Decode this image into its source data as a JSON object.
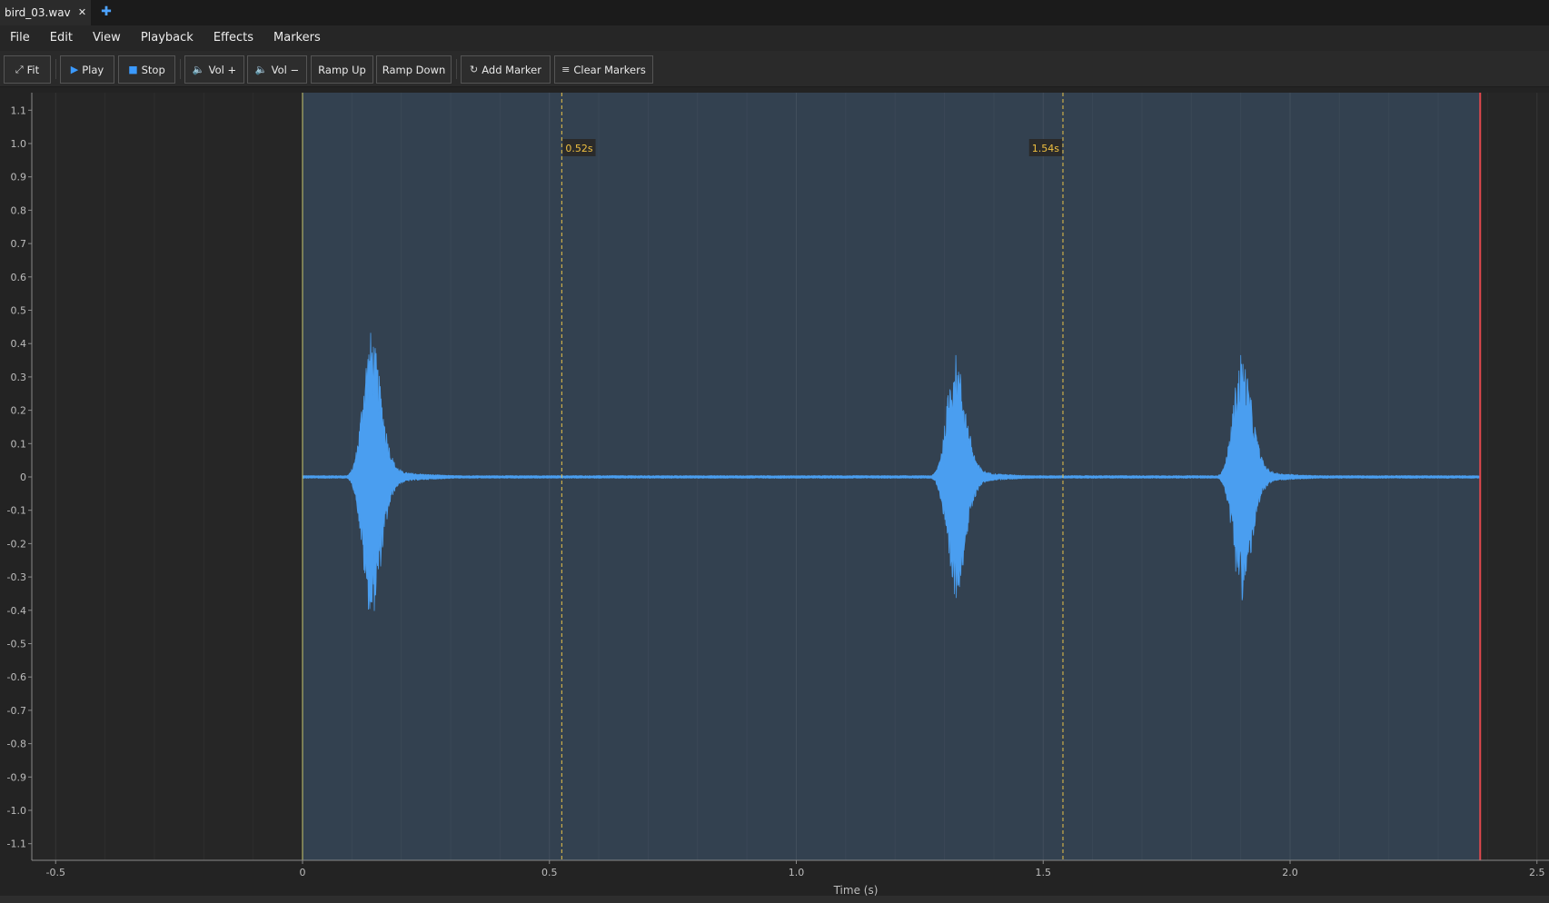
{
  "tab": {
    "title": "bird_03.wav",
    "close_glyph": "✕",
    "add_glyph": "✚"
  },
  "menu": [
    "File",
    "Edit",
    "View",
    "Playback",
    "Effects",
    "Markers"
  ],
  "toolbar": {
    "fit": {
      "label": "Fit",
      "icon": "expand-icon"
    },
    "play": {
      "label": "Play",
      "icon": "play-icon"
    },
    "stop": {
      "label": "Stop",
      "icon": "stop-icon"
    },
    "vol_up": {
      "label": "Vol +",
      "icon": "speaker-icon"
    },
    "vol_down": {
      "label": "Vol −",
      "icon": "speaker-icon"
    },
    "ramp_up": {
      "label": "Ramp Up"
    },
    "ramp_down": {
      "label": "Ramp Down"
    },
    "add_marker": {
      "label": "Add Marker",
      "icon": "marker-icon"
    },
    "clear_markers": {
      "label": "Clear Markers",
      "icon": "clear-icon"
    }
  },
  "chart_data": {
    "type": "line",
    "xlabel": "Time (s)",
    "ylabel": "",
    "xlim": [
      -0.5,
      2.5
    ],
    "ylim": [
      -1.15,
      1.15
    ],
    "x_ticks": [
      -0.5,
      0,
      0.5,
      1.0,
      1.5,
      2.0,
      2.5
    ],
    "x_tick_labels": [
      "-0.5",
      "0",
      "0.5",
      "1.0",
      "1.5",
      "2.0",
      "2.5"
    ],
    "y_ticks": [
      1.1,
      1.0,
      0.9,
      0.8,
      0.7,
      0.6,
      0.5,
      0.4,
      0.3,
      0.2,
      0.1,
      0,
      -0.1,
      -0.2,
      -0.3,
      -0.4,
      -0.5,
      -0.6,
      -0.7,
      -0.8,
      -0.9,
      -1.0,
      -1.1
    ],
    "y_tick_labels": [
      "1.1",
      "1.0",
      "0.9",
      "0.8",
      "0.7",
      "0.6",
      "0.5",
      "0.4",
      "0.3",
      "0.2",
      "0.1",
      "0",
      "-0.1",
      "-0.2",
      "-0.3",
      "-0.4",
      "-0.5",
      "-0.6",
      "-0.7",
      "-0.8",
      "-0.9",
      "-1.0",
      "-1.1"
    ],
    "audio_range": [
      0,
      2.385
    ],
    "playhead": 2.385,
    "markers": [
      {
        "time": 0.525,
        "label": "0.52s"
      },
      {
        "time": 1.54,
        "label": "1.54s"
      }
    ],
    "chirps": [
      {
        "center": 0.137,
        "peak_pos": 0.41,
        "peak_neg": -0.4
      },
      {
        "center": 1.32,
        "peak_pos": 0.34,
        "peak_neg": -0.35
      },
      {
        "center": 1.9,
        "peak_pos": 0.35,
        "peak_neg": -0.33
      }
    ],
    "grid": true,
    "colors": {
      "waveform": "#4a9ef0",
      "audio_bg": "#334150",
      "start_line": "#c8c870",
      "playhead": "#e0474c",
      "marker": "#e8c24a",
      "marker_text": "#f0c040"
    }
  }
}
